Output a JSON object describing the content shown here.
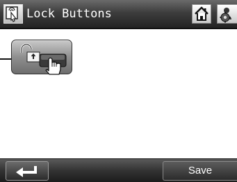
{
  "header": {
    "title": "Lock Buttons",
    "title_icon": "screen-touch-icon",
    "home_icon": "home-icon",
    "settings_icon": "gear-icon"
  },
  "main": {
    "lock_button_icon": "lock-button-touch-icon"
  },
  "footer": {
    "back_icon": "return-arrow-icon",
    "save_label": "Save"
  },
  "colors": {
    "bar_dark": "#232323",
    "button_gray": "#8f8f8f",
    "text": "#ffffff"
  }
}
